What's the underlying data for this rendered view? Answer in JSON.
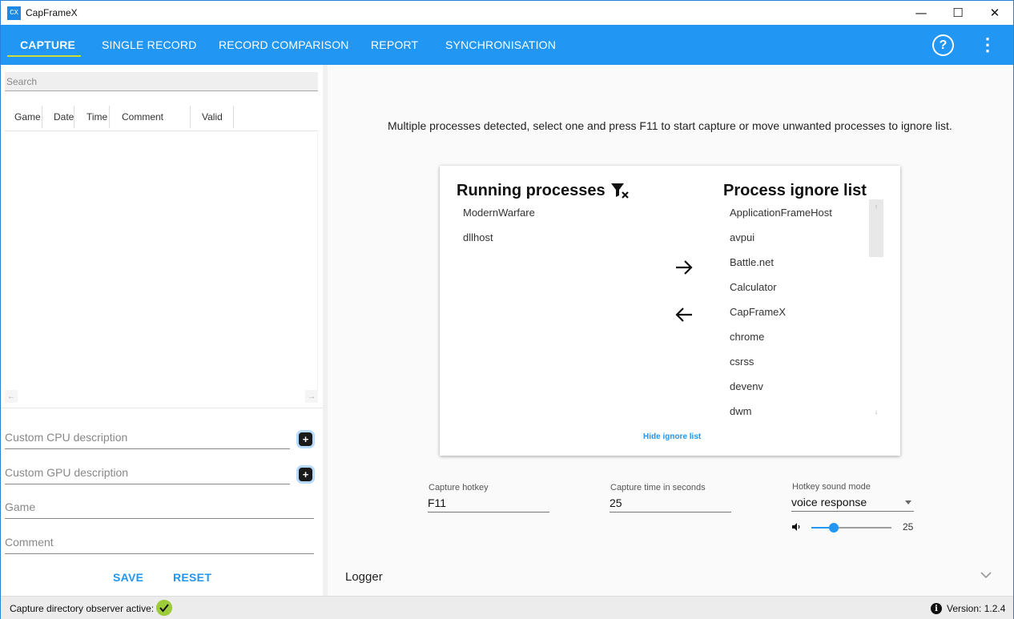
{
  "window": {
    "title": "CapFrameX",
    "logo_text": "CX",
    "minimize_glyph": "—",
    "maximize_glyph": "☐",
    "close_glyph": "✕"
  },
  "nav": {
    "tabs": [
      {
        "label": "CAPTURE",
        "active": true
      },
      {
        "label": "SINGLE RECORD",
        "active": false
      },
      {
        "label": "RECORD COMPARISON",
        "active": false
      },
      {
        "label": "REPORT",
        "active": false
      },
      {
        "label": "SYNCHRONISATION",
        "active": false
      }
    ],
    "help_glyph": "?",
    "more_glyph": "⋮",
    "accent_color": "#2196f3",
    "underline_color": "#cddc39"
  },
  "left": {
    "search_placeholder": "Search",
    "columns": [
      "Game",
      "Date",
      "Time",
      "Comment",
      "Valid"
    ],
    "cpu_placeholder": "Custom CPU description",
    "gpu_placeholder": "Custom GPU description",
    "game_placeholder": "Game",
    "comment_placeholder": "Comment",
    "plus_glyph": "+",
    "save_label": "SAVE",
    "reset_label": "RESET",
    "scroll_left_glyph": "←",
    "scroll_right_glyph": "→"
  },
  "main": {
    "instruction": "Multiple processes detected, select one and press F11 to start capture or move unwanted processes to ignore list.",
    "running_title": "Running processes",
    "ignore_title": "Process ignore list",
    "running_processes": [
      "ModernWarfare",
      "dllhost"
    ],
    "ignore_processes": [
      "ApplicationFrameHost",
      "avpui",
      "Battle.net",
      "Calculator",
      "CapFrameX",
      "chrome",
      "csrss",
      "devenv",
      "dwm"
    ],
    "hide_ignore_label": "Hide ignore list",
    "scroll_up_glyph": "↑",
    "scroll_down_glyph": "↓",
    "filter_icon": "filter-clear-icon",
    "move_right_icon": "arrow-right-icon",
    "move_left_icon": "arrow-left-icon"
  },
  "settings": {
    "hotkey_label": "Capture hotkey",
    "hotkey_value": "F11",
    "time_label": "Capture time in seconds",
    "time_value": "25",
    "sound_label": "Hotkey sound mode",
    "sound_value": "voice response",
    "volume_value": "25",
    "volume_fraction": 0.28
  },
  "logger": {
    "label": "Logger"
  },
  "status": {
    "observer_text": "Capture directory observer active:",
    "version_text": "Version:  1.2.4",
    "info_glyph": "i",
    "ok_color": "#9ccc3a"
  }
}
